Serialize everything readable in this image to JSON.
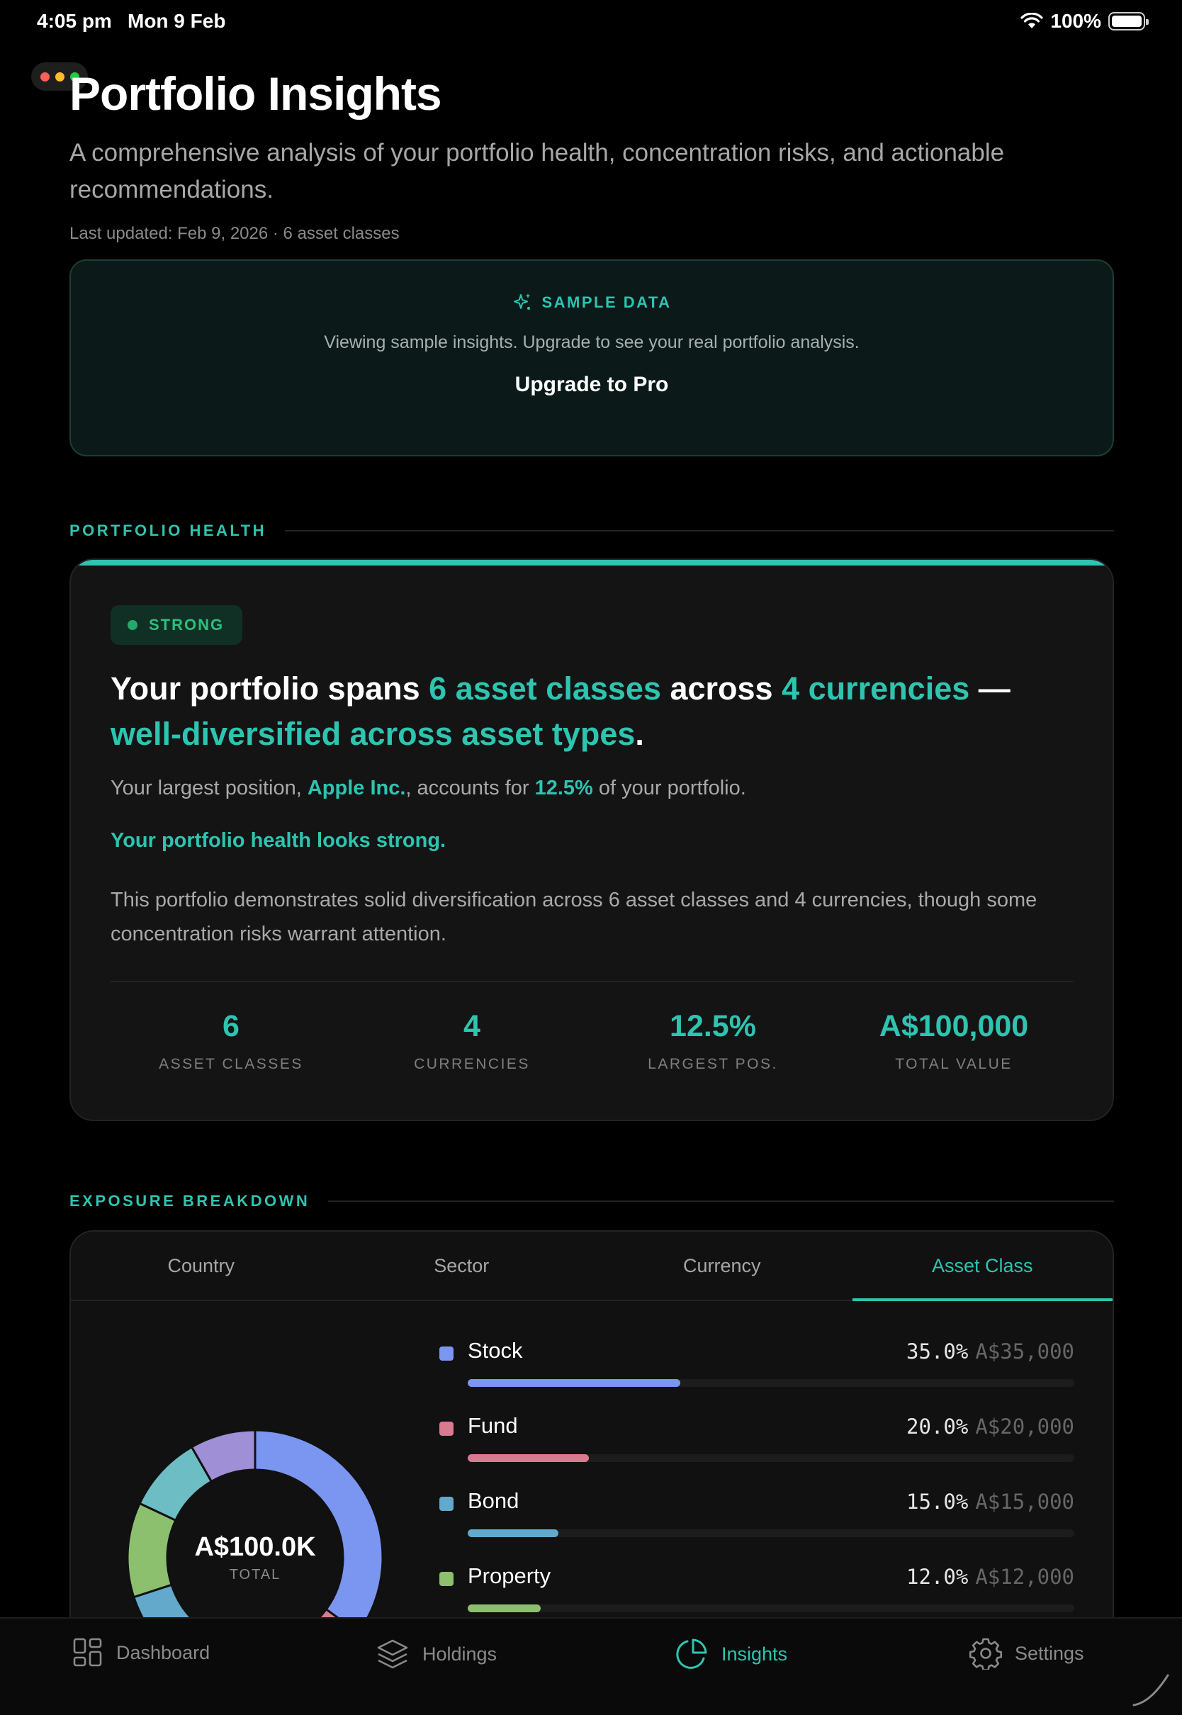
{
  "status_bar": {
    "time": "4:05 pm",
    "date": "Mon 9 Feb",
    "battery": "100%"
  },
  "header": {
    "title": "Portfolio Insights",
    "subtitle": "A comprehensive analysis of your portfolio health, concentration risks, and actionable recommendations.",
    "meta": "Last updated: Feb 9, 2026 · 6 asset classes"
  },
  "sample_banner": {
    "title": "SAMPLE DATA",
    "text": "Viewing sample insights. Upgrade to see your real portfolio analysis.",
    "button": "Upgrade to Pro",
    "icon": "sparkle-icon"
  },
  "health": {
    "section_label": "PORTFOLIO HEALTH",
    "badge": "STRONG",
    "headline": {
      "part1": "Your portfolio spans ",
      "hl1": "6 asset classes",
      "part2": " across ",
      "hl2": "4 currencies",
      "part3": " — ",
      "hl3": "well-diversified across asset types",
      "part4": "."
    },
    "largest": {
      "prefix": "Your largest position, ",
      "name": "Apple Inc.",
      "middle": ", accounts for ",
      "pct": "12.5%",
      "suffix": " of your portfolio."
    },
    "verdict": "Your portfolio health looks strong.",
    "summary": "This portfolio demonstrates solid diversification across 6 asset classes and 4 currencies, though some concentration risks warrant attention.",
    "stats": [
      {
        "value": "6",
        "label": "ASSET CLASSES"
      },
      {
        "value": "4",
        "label": "CURRENCIES"
      },
      {
        "value": "12.5%",
        "label": "LARGEST POS."
      },
      {
        "value": "A$100,000",
        "label": "TOTAL VALUE"
      }
    ]
  },
  "exposure": {
    "section_label": "EXPOSURE BREAKDOWN",
    "tabs": [
      "Country",
      "Sector",
      "Currency",
      "Asset Class"
    ],
    "active_tab": "Asset Class",
    "donut_total": "A$100.0K",
    "donut_sub": "TOTAL",
    "items": [
      {
        "name": "Stock",
        "pct": "35.0%",
        "amount": "A$35,000",
        "value": 35,
        "color": "#7b96f0"
      },
      {
        "name": "Fund",
        "pct": "20.0%",
        "amount": "A$20,000",
        "value": 20,
        "color": "#d97a90"
      },
      {
        "name": "Bond",
        "pct": "15.0%",
        "amount": "A$15,000",
        "value": 15,
        "color": "#62a9cc"
      },
      {
        "name": "Property",
        "pct": "12.0%",
        "amount": "A$12,000",
        "value": 12,
        "color": "#8cc06e"
      }
    ],
    "donut_other_colors": [
      "#6dbec4",
      "#9f8fd6"
    ]
  },
  "tabbar": {
    "items": [
      {
        "label": "Dashboard",
        "icon": "dashboard-icon"
      },
      {
        "label": "Holdings",
        "icon": "layers-icon"
      },
      {
        "label": "Insights",
        "icon": "pie-chart-icon"
      },
      {
        "label": "Settings",
        "icon": "gear-icon"
      }
    ],
    "active": "Insights"
  },
  "colors": {
    "accent": "#2ec4b0",
    "background": "#000000",
    "card": "#141414",
    "strong_green": "#2ebf7c"
  }
}
